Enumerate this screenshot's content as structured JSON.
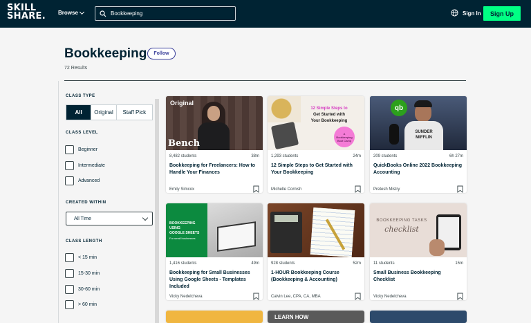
{
  "header": {
    "logo_line1": "SKILL",
    "logo_line2": "SHARE.",
    "browse_label": "Browse",
    "search_value": "Bookkeeping",
    "sign_in_label": "Sign In",
    "sign_up_label": "Sign Up"
  },
  "page": {
    "title": "Bookkeeping",
    "follow_label": "Follow",
    "results": "72 Results"
  },
  "filters": {
    "class_type_label": "CLASS TYPE",
    "class_type_options": [
      "All",
      "Original",
      "Staff Pick"
    ],
    "class_level_label": "CLASS LEVEL",
    "class_levels": [
      "Beginner",
      "Intermediate",
      "Advanced"
    ],
    "created_within_label": "CREATED WITHIN",
    "created_within_value": "All Time",
    "class_length_label": "CLASS LENGTH",
    "class_lengths": [
      "< 15 min",
      "15-30 min",
      "30-60 min",
      "> 60 min"
    ]
  },
  "cards": [
    {
      "students": "8,482 students",
      "duration": "38m",
      "title": "Bookkeeping for Freelancers: How to Handle Your Finances",
      "teacher": "Emily Simcox",
      "thumb_top": "Original",
      "thumb_brand": "Bench"
    },
    {
      "students": "1,293 students",
      "duration": "24m",
      "title": "12 Simple Steps to Get Started with Your Bookkeeping",
      "teacher": "Michelle Cornish",
      "thumb_line1": "12 Simple Steps to",
      "thumb_line2": "Get Started with",
      "thumb_line3": "Your Bookkeeping",
      "thumb_badge": "A Bookkeeping Boot Camp"
    },
    {
      "students": "209 students",
      "duration": "6h 27m",
      "title": "QuickBooks Online 2022 Bookkeeping Accounting",
      "teacher": "Pretesh Mistry",
      "thumb_logo": "qb",
      "thumb_shirt1": "SUNDER",
      "thumb_shirt2": "MIFFLIN"
    },
    {
      "students": "1,416 students",
      "duration": "49m",
      "title": "Bookkeeping for Small Businesses Using Google Sheets - Templates Included",
      "teacher": "Vicky Nedelcheva",
      "thumb_line1": "BOOKKEEPING",
      "thumb_line2": "USING",
      "thumb_line3": "GOOGLE SHEETS",
      "thumb_line4": "For small businesses"
    },
    {
      "students": "928 students",
      "duration": "52m",
      "title": "1-HOUR Bookkeeping Course (Bookkeeping & Accounting)",
      "teacher": "Calvin Lee, CPA, CA, MBA"
    },
    {
      "students": "11 students",
      "duration": "15m",
      "title": "Small Business Bookkeeping Checklist",
      "teacher": "Vicky Nedelcheva",
      "thumb_line1": "BOOKKEEPING TASKS",
      "thumb_line2": "checklist"
    }
  ],
  "peek": {
    "learn_how": "LEARN HOW"
  },
  "colors": {
    "navy": "#002333",
    "accent_green": "#00ff84",
    "follow": "#3a3f9a"
  }
}
